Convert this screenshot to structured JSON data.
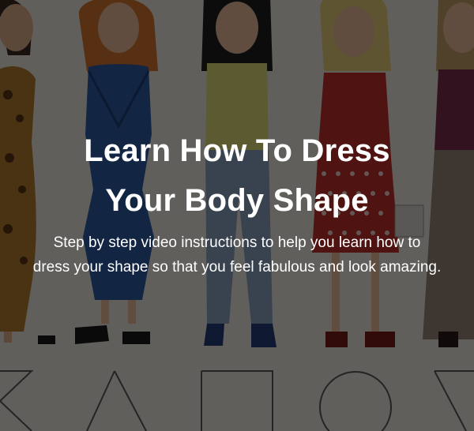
{
  "hero": {
    "title_line1": "Learn How To Dress",
    "title_line2": "Your Body Shape",
    "subtitle_line1": "Step by step video instructions to help you learn how to",
    "subtitle_line2": "dress your shape so that you feel fabulous and look amazing."
  },
  "colors": {
    "overlay": "#000000",
    "text": "#ffffff",
    "dress_leopard": "#b8802f",
    "dress_blue": "#2f5ca8",
    "top_yellow": "#e6e07a",
    "pants_plaid": "#8fa6c6",
    "dress_red": "#c6332c",
    "dress_plum": "#7a2d4b"
  },
  "illustration": {
    "figures": [
      {
        "name": "leopard-dress-figure"
      },
      {
        "name": "blue-dress-figure"
      },
      {
        "name": "yellow-top-figure"
      },
      {
        "name": "red-dress-figure"
      },
      {
        "name": "plum-dress-figure"
      }
    ],
    "shapes": [
      "hourglass-shape",
      "triangle-shape",
      "rectangle-shape",
      "circle-shape",
      "inverted-triangle-shape"
    ]
  }
}
